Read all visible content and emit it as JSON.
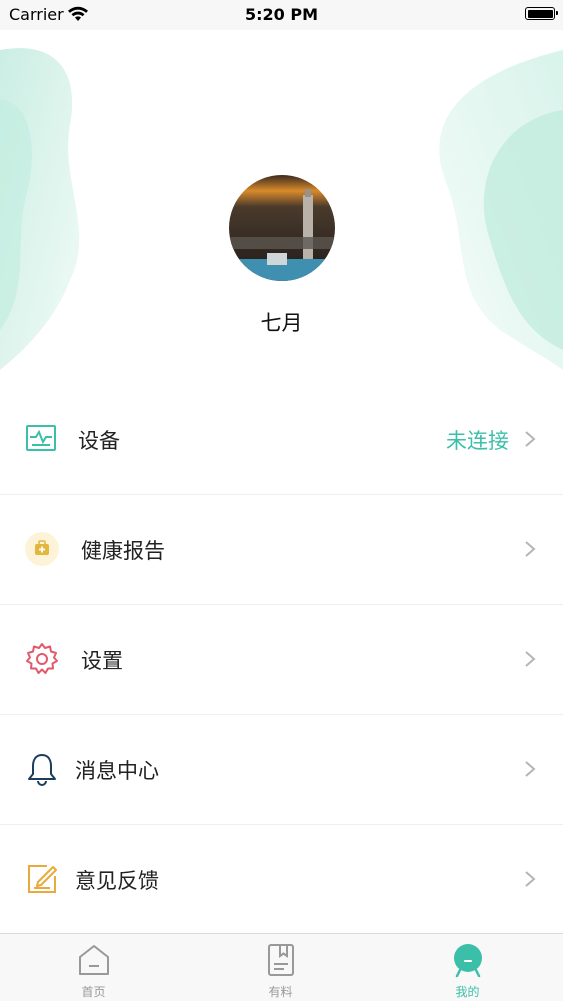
{
  "status_bar": {
    "carrier": "Carrier",
    "time": "5:20 PM"
  },
  "profile": {
    "username": "七月"
  },
  "menu": [
    {
      "label": "设备",
      "value": "未连接",
      "icon": "device-monitor-icon"
    },
    {
      "label": "健康报告",
      "value": "",
      "icon": "health-report-icon"
    },
    {
      "label": "设置",
      "value": "",
      "icon": "gear-icon"
    },
    {
      "label": "消息中心",
      "value": "",
      "icon": "bell-icon"
    },
    {
      "label": "意见反馈",
      "value": "",
      "icon": "feedback-edit-icon"
    }
  ],
  "tabs": [
    {
      "label": "首页",
      "icon": "home-icon",
      "active": false
    },
    {
      "label": "有料",
      "icon": "book-icon",
      "active": false
    },
    {
      "label": "我的",
      "icon": "profile-icon",
      "active": true
    }
  ],
  "colors": {
    "accent": "#3cbfa8",
    "decoration": "#c9efe3",
    "text": "#222222"
  }
}
